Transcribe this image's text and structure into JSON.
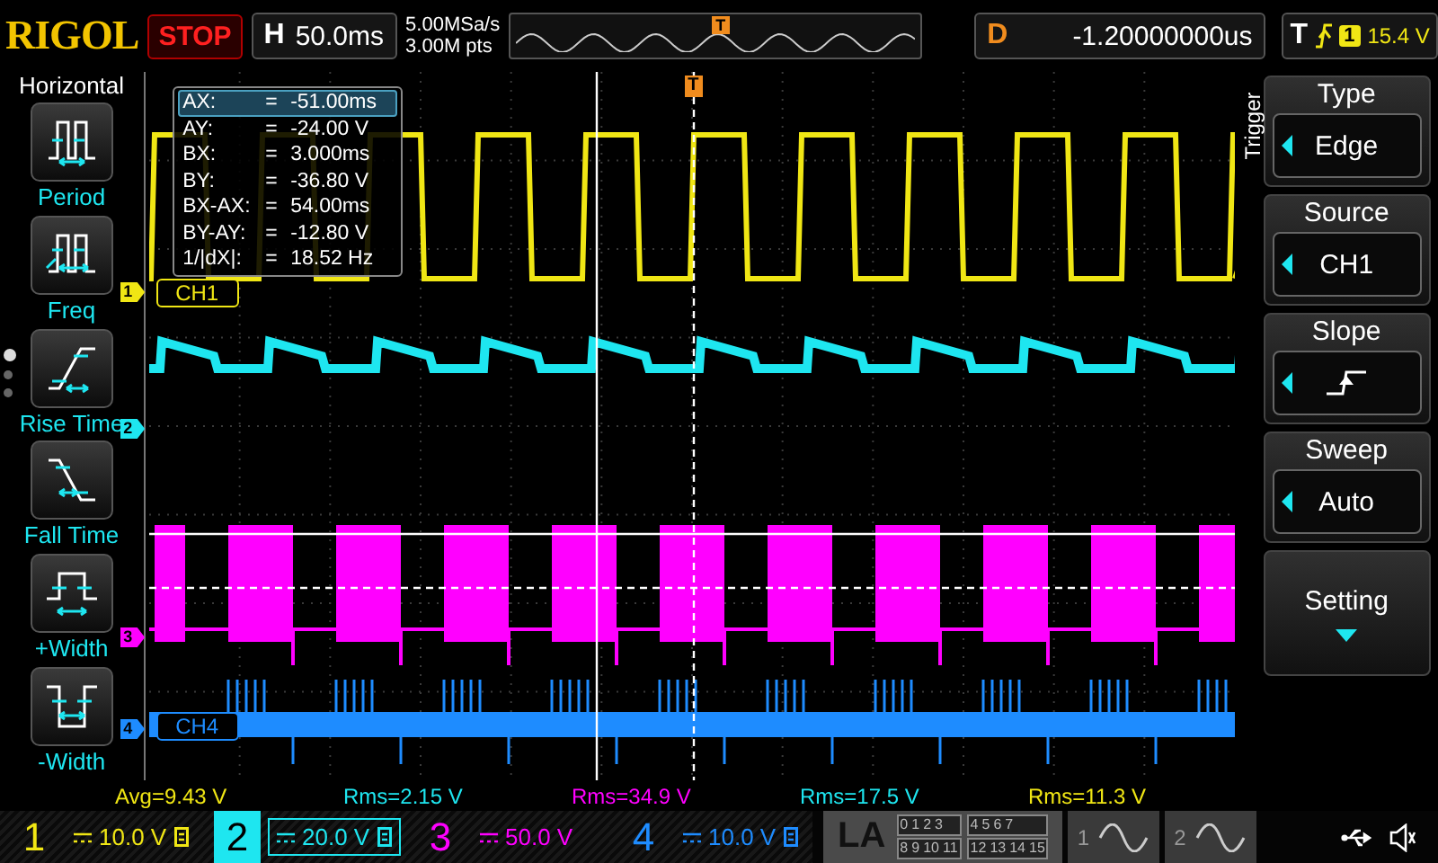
{
  "top_bar": {
    "logo": "RIGOL",
    "run_state": "STOP",
    "horizontal": {
      "label": "H",
      "timebase": "50.0ms"
    },
    "sample_rate": "5.00MSa/s",
    "memory_depth": "3.00M pts",
    "overview_marker": "T",
    "delay": {
      "label": "D",
      "value": "-1.20000000us"
    },
    "trigger": {
      "label": "T",
      "source": "1",
      "level": "15.4 V"
    }
  },
  "measure_menu": {
    "title": "Horizontal",
    "pages": [
      {
        "selected": true
      },
      {
        "selected": false
      },
      {
        "selected": false
      }
    ],
    "items": [
      {
        "kind": "period",
        "label": "Period"
      },
      {
        "kind": "freq",
        "label": "Freq"
      },
      {
        "kind": "rise",
        "label": "Rise Time"
      },
      {
        "kind": "fall",
        "label": "Fall Time"
      },
      {
        "kind": "pwidth",
        "label": "+Width"
      },
      {
        "kind": "nwidth",
        "label": "-Width"
      }
    ]
  },
  "display": {
    "trigger_marker": "T",
    "cursor_readouts": [
      {
        "label": "AX:",
        "sign": "=",
        "value": "-51.00ms",
        "selected": true
      },
      {
        "label": "AY:",
        "sign": "=",
        "value": "-24.00 V",
        "selected": false
      },
      {
        "label": "BX:",
        "sign": "=",
        "value": "3.000ms",
        "selected": false
      },
      {
        "label": "BY:",
        "sign": "=",
        "value": "-36.80 V",
        "selected": false
      },
      {
        "label": "BX-AX:",
        "sign": "=",
        "value": "54.00ms",
        "selected": false
      },
      {
        "label": "BY-AY:",
        "sign": "=",
        "value": "-12.80 V",
        "selected": false
      },
      {
        "label": "1/|dX|:",
        "sign": "=",
        "value": "18.52 Hz",
        "selected": false
      }
    ],
    "channel_markers": [
      {
        "label": "1",
        "color": "#f0e614"
      },
      {
        "label": "2",
        "color": "#1ee6f0"
      },
      {
        "label": "3",
        "color": "#ff00ff"
      },
      {
        "label": "4",
        "color": "#1e8cff"
      }
    ],
    "channel_tags": [
      {
        "text": "CH1",
        "color": "#f0e614"
      },
      {
        "text": "CH4",
        "color": "#1e8cff"
      }
    ]
  },
  "measurements": [
    {
      "text": "Avg=9.43 V",
      "color": "#f0e614"
    },
    {
      "text": "Rms=2.15 V",
      "color": "#1ee6f0"
    },
    {
      "text": "Rms=34.9 V",
      "color": "#ff00ff"
    },
    {
      "text": "Rms=17.5 V",
      "color": "#1ee6f0"
    },
    {
      "text": "Rms=11.3 V",
      "color": "#f0e614"
    }
  ],
  "channels": [
    {
      "number": "1",
      "scale": "10.0 V",
      "color": "#f0e614",
      "selected": false,
      "bw_limit": true
    },
    {
      "number": "2",
      "scale": "20.0 V",
      "color": "#1ee6f0",
      "selected": true,
      "bw_limit": true
    },
    {
      "number": "3",
      "scale": "50.0 V",
      "color": "#ff00ff",
      "selected": false,
      "bw_limit": false
    },
    {
      "number": "4",
      "scale": "10.0 V",
      "color": "#1e8cff",
      "selected": false,
      "bw_limit": true
    }
  ],
  "logic_analyzer": {
    "label": "LA",
    "bit_groups": [
      [
        "0",
        "1",
        "2",
        "3"
      ],
      [
        "4",
        "5",
        "6",
        "7"
      ],
      [
        "8",
        "9",
        "10",
        "11"
      ],
      [
        "12",
        "13",
        "14",
        "15"
      ]
    ]
  },
  "math": [
    {
      "number": "1"
    },
    {
      "number": "2"
    }
  ],
  "trigger_menu": {
    "title": "Trigger",
    "items": [
      {
        "kind": "choice",
        "label": "Type",
        "value": "Edge"
      },
      {
        "kind": "choice",
        "label": "Source",
        "value": "CH1"
      },
      {
        "kind": "slope",
        "label": "Slope"
      },
      {
        "kind": "choice",
        "label": "Sweep",
        "value": "Auto"
      },
      {
        "kind": "action",
        "label": "Setting"
      }
    ]
  }
}
